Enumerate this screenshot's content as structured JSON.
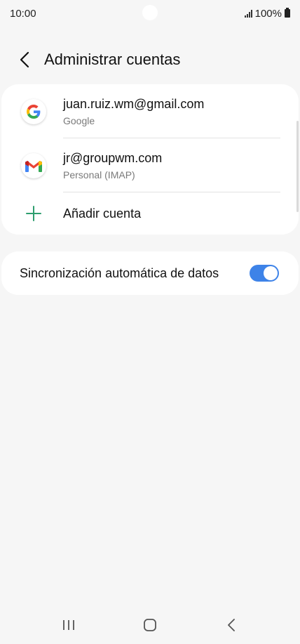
{
  "status_bar": {
    "time": "10:00",
    "battery": "100%",
    "icons": [
      "signal-icon",
      "battery-icon"
    ]
  },
  "header": {
    "title": "Administrar cuentas",
    "back_icon": "chevron-left-icon"
  },
  "accounts": [
    {
      "email": "juan.ruiz.wm@gmail.com",
      "type": "Google",
      "icon": "google-icon"
    },
    {
      "email": "jr@groupwm.com",
      "type": "Personal (IMAP)",
      "icon": "gmail-icon"
    }
  ],
  "add_account": {
    "label": "Añadir cuenta",
    "icon": "plus-icon"
  },
  "sync": {
    "label": "Sincronización automática de datos",
    "enabled": true
  },
  "colors": {
    "accent": "#3e83e8",
    "add_icon": "#2e9e6e",
    "background": "#f6f6f6"
  },
  "nav": {
    "icons": [
      "recents-icon",
      "home-icon",
      "back-icon"
    ]
  }
}
